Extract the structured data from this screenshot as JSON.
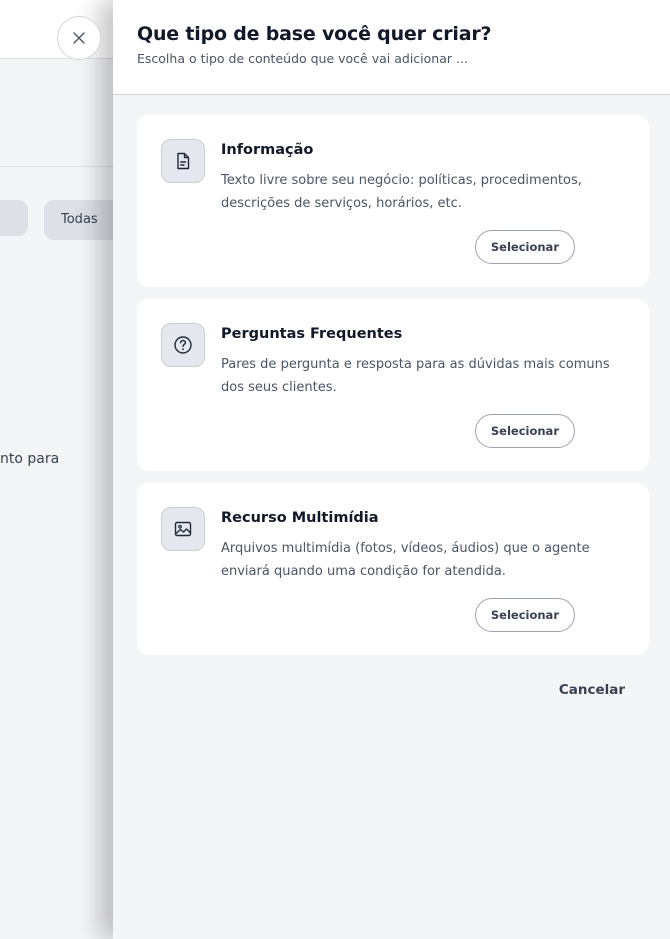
{
  "background": {
    "filter_button_label": "Todas",
    "partial_text": "nto para",
    "close_icon": "close-icon"
  },
  "drawer": {
    "title": "Que tipo de base você quer criar?",
    "subtitle": "Escolha o tipo de conteúdo que você vai adicionar ...",
    "cancel_label": "Cancelar",
    "cards": [
      {
        "icon": "document-icon",
        "title": "Informação",
        "description": "Texto livre sobre seu negócio: políticas, procedimentos, descrições de serviços, horários, etc.",
        "button_label": "Selecionar"
      },
      {
        "icon": "question-circle-icon",
        "title": "Perguntas Frequentes",
        "description": "Pares de pergunta e resposta para as dúvidas mais comuns dos seus clientes.",
        "button_label": "Selecionar"
      },
      {
        "icon": "image-icon",
        "title": "Recurso Multimídia",
        "description": "Arquivos multimídia (fotos, vídeos, áudios) que o agente enviará quando uma condição for atendida.",
        "button_label": "Selecionar"
      }
    ]
  }
}
